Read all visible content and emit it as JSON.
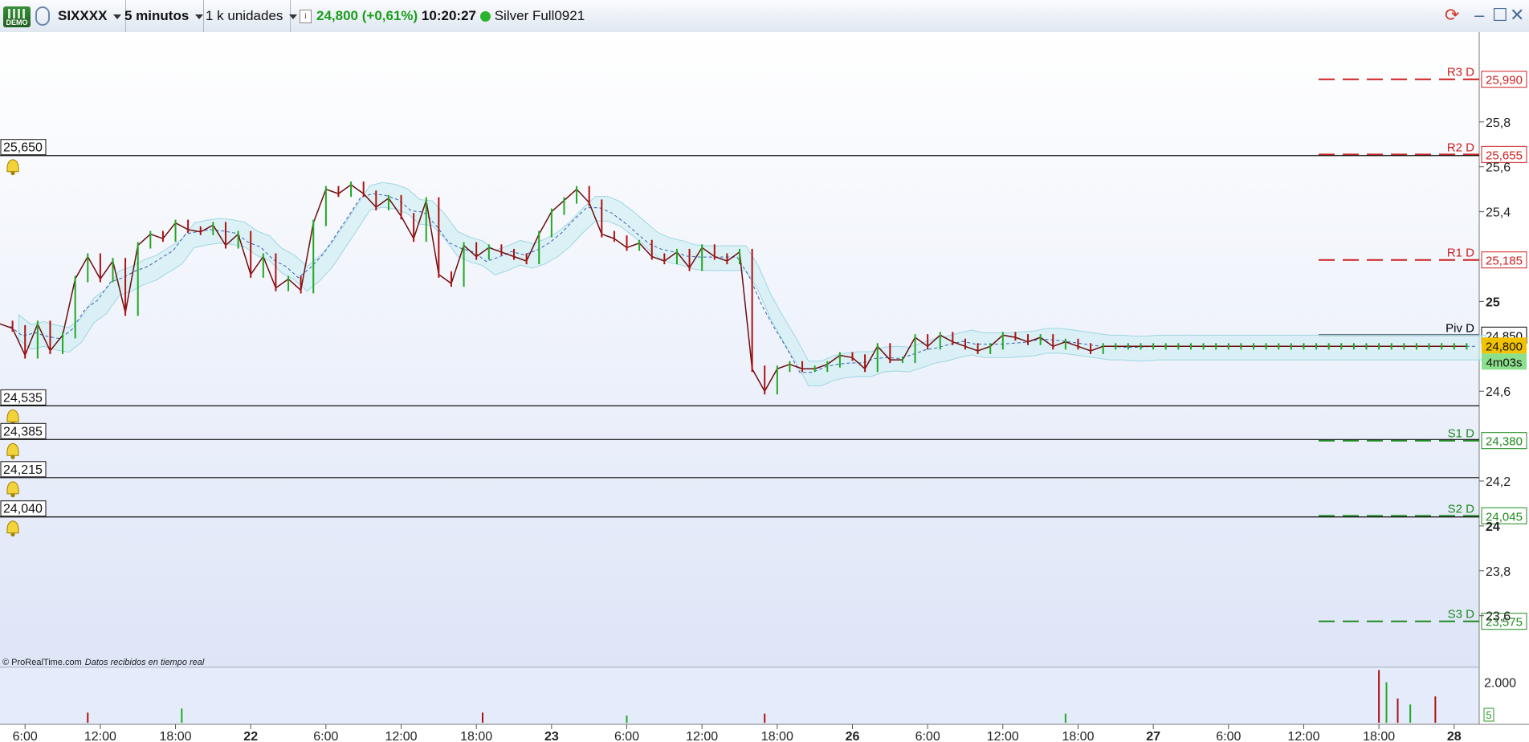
{
  "toolbar": {
    "demo_label": "DEMO",
    "instrument": "SIXXXX",
    "timeframe": "5 minutos",
    "units": "1 k unidades",
    "info_icon": "i",
    "price": "24,800",
    "change": "(+0,61%)",
    "time": "10:20:27",
    "contract": "Silver Full0921"
  },
  "footer": {
    "copyright": "© ProRealTime.com",
    "status": "Datos recibidos en tiempo real"
  },
  "colors": {
    "up": "#22a822",
    "down": "#b01010",
    "close_line": "#6b0d0d",
    "cloud_up": "#cfeef3",
    "cloud_down": "#f8d4d4",
    "resistance": "#cc1f1f",
    "support": "#1f8a1f",
    "pivot": "#000000",
    "price_tag": "#f2c200",
    "timer_tag": "#8be08b"
  },
  "chart_data": {
    "type": "line",
    "title": "SIXXXX",
    "price_axis": {
      "ylim": [
        23.37,
        26.2
      ],
      "ticks": [
        {
          "value": 25.8,
          "label": "25,8"
        },
        {
          "value": 25.6,
          "label": "25,6"
        },
        {
          "value": 25.4,
          "label": "25,4"
        },
        {
          "value": 25.0,
          "label": "25"
        },
        {
          "value": 24.6,
          "label": "24,6"
        },
        {
          "value": 24.2,
          "label": "24,2"
        },
        {
          "value": 24.0,
          "label": "24"
        },
        {
          "value": 23.8,
          "label": "23,8"
        },
        {
          "value": 23.6,
          "label": "23,6"
        }
      ]
    },
    "x_axis": {
      "xlim": [
        0,
        118
      ],
      "ticks": [
        {
          "x": 2,
          "label": "6:00",
          "bold": false
        },
        {
          "x": 8,
          "label": "12:00",
          "bold": false
        },
        {
          "x": 14,
          "label": "18:00",
          "bold": false
        },
        {
          "x": 20,
          "label": "22",
          "bold": true
        },
        {
          "x": 26,
          "label": "6:00",
          "bold": false
        },
        {
          "x": 32,
          "label": "12:00",
          "bold": false
        },
        {
          "x": 38,
          "label": "18:00",
          "bold": false
        },
        {
          "x": 44,
          "label": "23",
          "bold": true
        },
        {
          "x": 50,
          "label": "6:00",
          "bold": false
        },
        {
          "x": 56,
          "label": "12:00",
          "bold": false
        },
        {
          "x": 62,
          "label": "18:00",
          "bold": false
        },
        {
          "x": 68,
          "label": "26",
          "bold": true
        },
        {
          "x": 74,
          "label": "6:00",
          "bold": false
        },
        {
          "x": 80,
          "label": "12:00",
          "bold": false
        },
        {
          "x": 86,
          "label": "18:00",
          "bold": false
        },
        {
          "x": 92,
          "label": "27",
          "bold": true
        },
        {
          "x": 98,
          "label": "6:00",
          "bold": false
        },
        {
          "x": 104,
          "label": "12:00",
          "bold": false
        },
        {
          "x": 110,
          "label": "18:00",
          "bold": false
        },
        {
          "x": 116,
          "label": "28",
          "bold": true
        }
      ]
    },
    "price_series": {
      "name": "Silver Full0921",
      "x": [
        0,
        1,
        2,
        3,
        4,
        5,
        6,
        7,
        8,
        9,
        10,
        11,
        12,
        13,
        14,
        15,
        16,
        17,
        18,
        19,
        20,
        21,
        22,
        23,
        24,
        25,
        26,
        27,
        28,
        29,
        30,
        31,
        32,
        33,
        34,
        35,
        36,
        37,
        38,
        39,
        40,
        41,
        42,
        43,
        44,
        45,
        46,
        47,
        48,
        49,
        50,
        51,
        52,
        53,
        54,
        55,
        56,
        57,
        58,
        59,
        60,
        61,
        62,
        63,
        64,
        65,
        66,
        67,
        68,
        69,
        70,
        71,
        72,
        73,
        74,
        75,
        76,
        77,
        78,
        79,
        80,
        81,
        82,
        83,
        84,
        85,
        86,
        87,
        88,
        89,
        90,
        91,
        92,
        93,
        94,
        95,
        96,
        97,
        98,
        99,
        100,
        101,
        102,
        103,
        104,
        105,
        106,
        107,
        108,
        109,
        110,
        111,
        112,
        113,
        114,
        115,
        116,
        117
      ],
      "values": [
        24.9,
        24.88,
        24.76,
        24.9,
        24.78,
        24.85,
        25.1,
        25.2,
        25.1,
        25.18,
        24.95,
        25.25,
        25.3,
        25.28,
        25.35,
        25.32,
        25.31,
        25.34,
        25.25,
        25.3,
        25.12,
        25.2,
        25.06,
        25.1,
        25.05,
        25.35,
        25.5,
        25.48,
        25.52,
        25.48,
        25.42,
        25.46,
        25.38,
        25.28,
        25.45,
        25.12,
        25.08,
        25.25,
        25.2,
        25.24,
        25.22,
        25.2,
        25.18,
        25.3,
        25.4,
        25.45,
        25.5,
        25.44,
        25.3,
        25.28,
        25.24,
        25.26,
        25.2,
        25.18,
        25.22,
        25.15,
        25.24,
        25.2,
        25.18,
        25.22,
        24.7,
        24.6,
        24.7,
        24.72,
        24.7,
        24.7,
        24.72,
        24.76,
        24.75,
        24.7,
        24.8,
        24.74,
        24.74,
        24.84,
        24.8,
        24.85,
        24.82,
        24.8,
        24.78,
        24.8,
        24.85,
        24.84,
        24.82,
        24.84,
        24.8,
        24.82,
        24.8,
        24.78,
        24.8,
        24.8,
        24.8,
        24.8,
        24.8,
        24.8,
        24.8,
        24.8,
        24.8,
        24.8,
        24.8,
        24.8,
        24.8,
        24.8,
        24.8,
        24.8,
        24.8,
        24.8,
        24.8,
        24.8,
        24.8,
        24.8,
        24.8,
        24.8,
        24.8,
        24.8,
        24.8,
        24.8,
        24.8,
        24.8
      ]
    },
    "levels": [
      {
        "name": "R3 D",
        "value": 25.99,
        "label": "25,990",
        "kind": "resistance"
      },
      {
        "name": "R2 D",
        "value": 25.655,
        "label": "25,655",
        "kind": "resistance"
      },
      {
        "name": "R1 D",
        "value": 25.185,
        "label": "25,185",
        "kind": "resistance"
      },
      {
        "name": "Piv D",
        "value": 24.85,
        "label": "24,850",
        "kind": "pivot"
      },
      {
        "name": "S1 D",
        "value": 24.38,
        "label": "24,380",
        "kind": "support"
      },
      {
        "name": "S2 D",
        "value": 24.045,
        "label": "24,045",
        "kind": "support"
      },
      {
        "name": "S3 D",
        "value": 23.575,
        "label": "23,575",
        "kind": "support"
      }
    ],
    "alert_lines": [
      {
        "value": 25.65,
        "label": "25,650"
      },
      {
        "value": 24.535,
        "label": "24,535"
      },
      {
        "value": 24.385,
        "label": "24,385"
      },
      {
        "value": 24.215,
        "label": "24,215"
      },
      {
        "value": 24.04,
        "label": "24,040"
      }
    ],
    "last_price": {
      "value": 24.8,
      "label": "24,800",
      "timer": "4m03s"
    },
    "volume": {
      "tick_label": "2.000",
      "corner_label": "5",
      "spikes": [
        {
          "x": 7,
          "value": 500
        },
        {
          "x": 14.5,
          "value": 700
        },
        {
          "x": 38.5,
          "value": 500
        },
        {
          "x": 50,
          "value": 350
        },
        {
          "x": 61,
          "value": 450
        },
        {
          "x": 85,
          "value": 450
        },
        {
          "x": 110,
          "value": 2600
        },
        {
          "x": 110.6,
          "value": 2000
        },
        {
          "x": 111.5,
          "value": 1200
        },
        {
          "x": 112.5,
          "value": 900
        },
        {
          "x": 114.5,
          "value": 1300
        }
      ]
    }
  }
}
